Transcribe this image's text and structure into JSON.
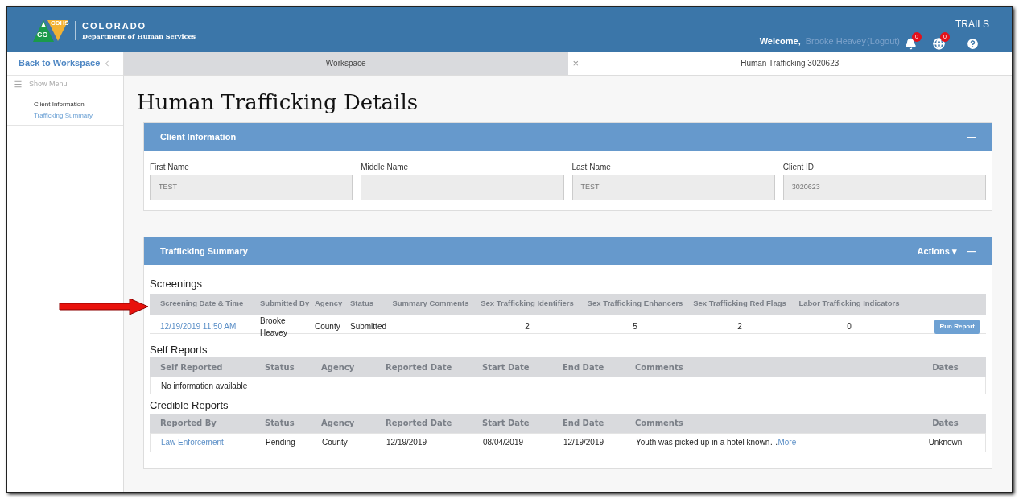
{
  "header": {
    "logo_badge": "CO",
    "logo_shield": "CDHS",
    "org_name": "COLORADO",
    "org_subtitle": "Department of Human Services",
    "app_name": "TRAILS",
    "welcome": "Welcome,",
    "user": "Brooke Heavey",
    "logout_open": "(",
    "logout": "Logout",
    "logout_close": ")",
    "notifications": "0",
    "messages": "0"
  },
  "sidebar": {
    "back": "Back to Workspace",
    "show_menu": "Show Menu",
    "items": [
      {
        "label": "Client Information",
        "selected": false
      },
      {
        "label": "Trafficking Summary",
        "selected": true
      }
    ]
  },
  "tabs": [
    {
      "label": "Workspace",
      "selected": false,
      "closable": false
    },
    {
      "label": "Human Trafficking 3020623",
      "selected": true,
      "closable": true
    }
  ],
  "close_glyph": "×",
  "page_title": "Human Trafficking Details",
  "client_info": {
    "title": "Client Information",
    "collapse": "—",
    "fields": [
      {
        "label": "First Name",
        "value": "TEST"
      },
      {
        "label": "Middle Name"
      },
      {
        "label": "Last Name",
        "value": "TEST"
      },
      {
        "label": "Client ID",
        "value": "3020623"
      }
    ]
  },
  "summary": {
    "title": "Trafficking Summary",
    "actions": "Actions ▾",
    "collapse": "—",
    "screenings": {
      "title": "Screenings",
      "columns": [
        "Screening Date & Time",
        "Submitted By",
        "Agency",
        "Status",
        "Summary Comments",
        "Sex Trafficking Identifiers",
        "Sex Trafficking Enhancers",
        "Sex Trafficking Red Flags",
        "Labor Trafficking Indicators"
      ],
      "rows": [
        {
          "date": "12/19/2019 11:50 AM",
          "submitted_by": "Brooke Heavey",
          "agency": "County",
          "status": "Submitted",
          "identifiers": "2",
          "enhancers": "5",
          "red_flags": "2",
          "labor": "0",
          "button": "Run Report"
        }
      ]
    },
    "self_reports": {
      "title": "Self Reports",
      "columns": [
        "Self Reported",
        "Status",
        "Agency",
        "Reported Date",
        "Start Date",
        "End Date",
        "Comments",
        "Dates"
      ],
      "empty": "No information available"
    },
    "credible_reports": {
      "title": "Credible Reports",
      "columns": [
        "Reported By",
        "Status",
        "Agency",
        "Reported Date",
        "Start Date",
        "End Date",
        "Comments",
        "Dates"
      ],
      "rows": [
        {
          "reported_by": "Law Enforcement",
          "status": "Pending",
          "agency": "County",
          "reported_date": "12/19/2019",
          "start_date": "08/04/2019",
          "end_date": "12/19/2019",
          "comments": "Youth was picked up in a hotel known…",
          "more": "More",
          "dates": "Unknown"
        }
      ]
    }
  }
}
